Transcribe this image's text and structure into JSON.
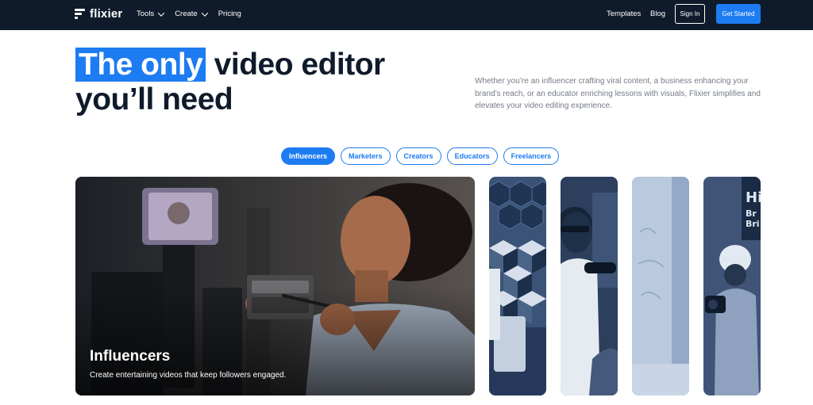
{
  "brand": {
    "name": "flixier"
  },
  "nav": {
    "left": [
      {
        "label": "Tools",
        "dropdown": true
      },
      {
        "label": "Create",
        "dropdown": true
      },
      {
        "label": "Pricing",
        "dropdown": false
      }
    ],
    "templates": "Templates",
    "blog": "Blog",
    "sign_in": "Sign In",
    "get_started": "Get Started"
  },
  "hero": {
    "highlight": "The only",
    "title_rest": " video editor",
    "title_line2": "you’ll need",
    "lead": "Whether you’re an influencer crafting viral content, a business enhancing your brand’s reach, or an educator enriching lessons with visuals, Flixier simplifies and elevates your video editing experience."
  },
  "tabs": [
    "Influencers",
    "Marketers",
    "Creators",
    "Educators",
    "Freelancers"
  ],
  "active_tab": "Influencers",
  "feature": {
    "title": "Influencers",
    "subtitle": "Create entertaining videos that keep followers engaged."
  },
  "colors": {
    "nav_bg": "#0f1b2b",
    "accent": "#1d7cf2",
    "heading": "#0f1b2b",
    "body_text": "#737b86"
  }
}
